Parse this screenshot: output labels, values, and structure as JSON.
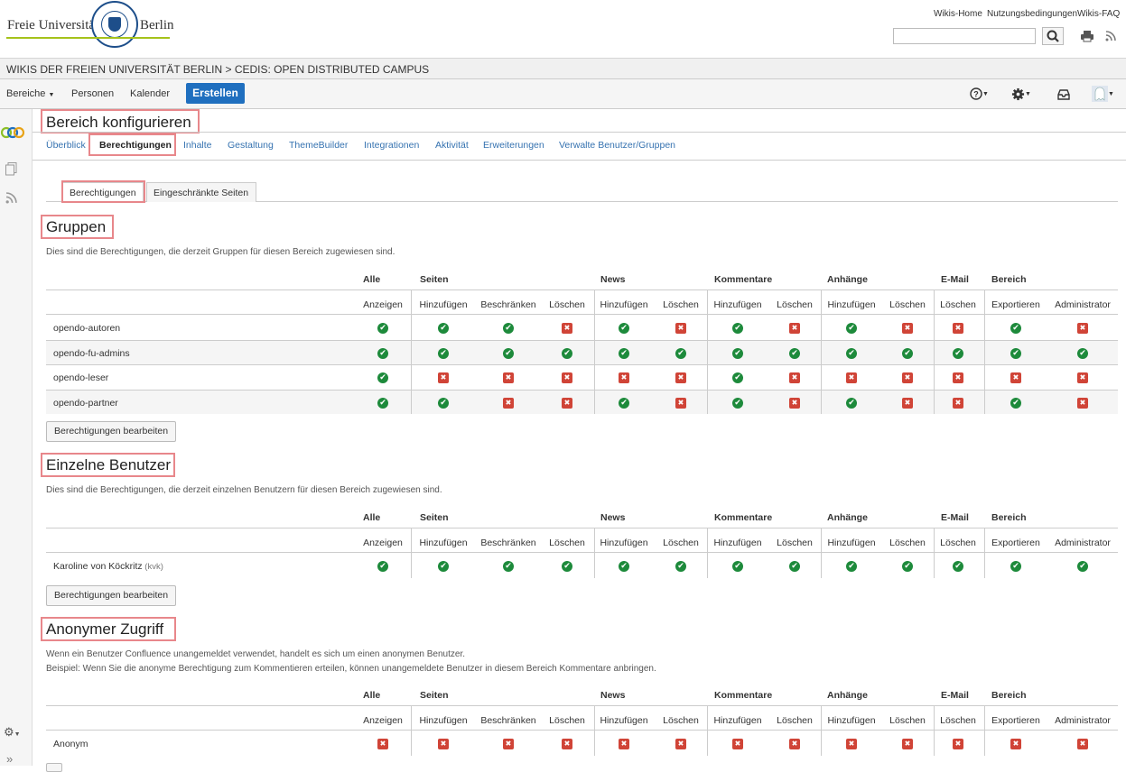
{
  "header": {
    "logo_left": "Freie Universität",
    "logo_right": "Berlin",
    "links": [
      "Wikis-Home",
      "Nutzungsbedingungen",
      "Wikis-FAQ"
    ],
    "search": {
      "value": "",
      "placeholder": ""
    }
  },
  "breadcrumb": "WIKIS DER FREIEN UNIVERSITÄT BERLIN > CEDIS: OPEN DISTRIBUTED CAMPUS",
  "nav": {
    "items": [
      "Bereiche",
      "Personen",
      "Kalender"
    ],
    "create": "Erstellen"
  },
  "page": {
    "title": "Bereich konfigurieren",
    "tabs": [
      "Überblick",
      "Berechtigungen",
      "Inhalte",
      "Gestaltung",
      "ThemeBuilder",
      "Integrationen",
      "Aktivität",
      "Erweiterungen",
      "Verwalte Benutzer/Gruppen"
    ],
    "active_tab": "Berechtigungen",
    "subtabs": [
      "Berechtigungen",
      "Eingeschränkte Seiten"
    ]
  },
  "table_header": {
    "groups": [
      "Alle",
      "Seiten",
      "News",
      "Kommentare",
      "Anhänge",
      "E-Mail",
      "Bereich"
    ],
    "columns": [
      "Anzeigen",
      "Hinzufügen",
      "Beschränken",
      "Löschen",
      "Hinzufügen",
      "Löschen",
      "Hinzufügen",
      "Löschen",
      "Hinzufügen",
      "Löschen",
      "Löschen",
      "Exportieren",
      "Administrator"
    ]
  },
  "groups_section": {
    "title": "Gruppen",
    "description": "Dies sind die Berechtigungen, die derzeit Gruppen für diesen Bereich zugewiesen sind.",
    "rows": [
      {
        "name": "opendo-autoren",
        "perms": [
          1,
          1,
          1,
          0,
          1,
          0,
          1,
          0,
          1,
          0,
          0,
          1,
          0
        ]
      },
      {
        "name": "opendo-fu-admins",
        "perms": [
          1,
          1,
          1,
          1,
          1,
          1,
          1,
          1,
          1,
          1,
          1,
          1,
          1
        ]
      },
      {
        "name": "opendo-leser",
        "perms": [
          1,
          0,
          0,
          0,
          0,
          0,
          1,
          0,
          0,
          0,
          0,
          0,
          0
        ]
      },
      {
        "name": "opendo-partner",
        "perms": [
          1,
          1,
          0,
          0,
          1,
          0,
          1,
          0,
          1,
          0,
          0,
          1,
          0
        ]
      }
    ],
    "button": "Berechtigungen bearbeiten"
  },
  "users_section": {
    "title": "Einzelne Benutzer",
    "description": "Dies sind die Berechtigungen, die derzeit einzelnen Benutzern für diesen Bereich zugewiesen sind.",
    "rows": [
      {
        "name": "Karoline von Köckritz",
        "uid": "(kvk)",
        "perms": [
          1,
          1,
          1,
          1,
          1,
          1,
          1,
          1,
          1,
          1,
          1,
          1,
          1
        ]
      }
    ],
    "button": "Berechtigungen bearbeiten"
  },
  "anon_section": {
    "title": "Anonymer Zugriff",
    "description_1": "Wenn ein Benutzer Confluence unangemeldet verwendet, handelt es sich um einen anonymen Benutzer.",
    "description_2": "Beispiel: Wenn Sie die anonyme Berechtigung zum Kommentieren erteilen, können unangemeldete Benutzer in diesem Bereich Kommentare anbringen.",
    "rows": [
      {
        "name": "Anonym",
        "perms": [
          0,
          0,
          0,
          0,
          0,
          0,
          0,
          0,
          0,
          0,
          0,
          0,
          0
        ]
      }
    ]
  },
  "colors": {
    "accent": "#1f6fbf",
    "link": "#3572b0",
    "yes": "#1d8a3b",
    "no": "#d04437",
    "highlight": "#e8878b"
  }
}
